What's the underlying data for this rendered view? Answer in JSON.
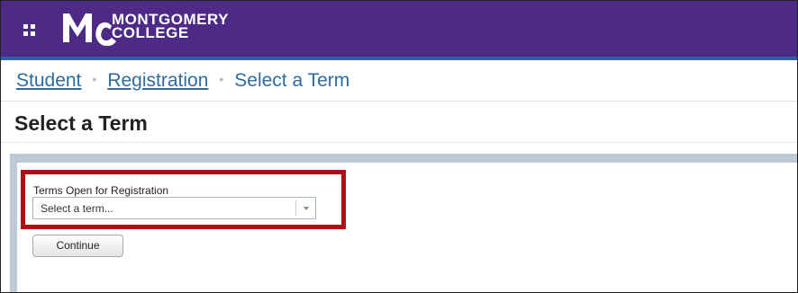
{
  "header": {
    "logo_line1": "MONTGOMERY",
    "logo_line2": "COLLEGE",
    "logo_mark": "MC",
    "brand_color": "#4c2a85",
    "accent_color": "#2e5fa8",
    "apps_icon": "grid-icon"
  },
  "breadcrumb": {
    "items": [
      "Student",
      "Registration"
    ],
    "current": "Select a Term",
    "separator": "•"
  },
  "page": {
    "title": "Select a Term"
  },
  "form": {
    "term_label": "Terms Open for Registration",
    "term_select": {
      "selected_text": "Select a term..."
    },
    "continue_label": "Continue",
    "highlight_color": "#b00f16"
  }
}
